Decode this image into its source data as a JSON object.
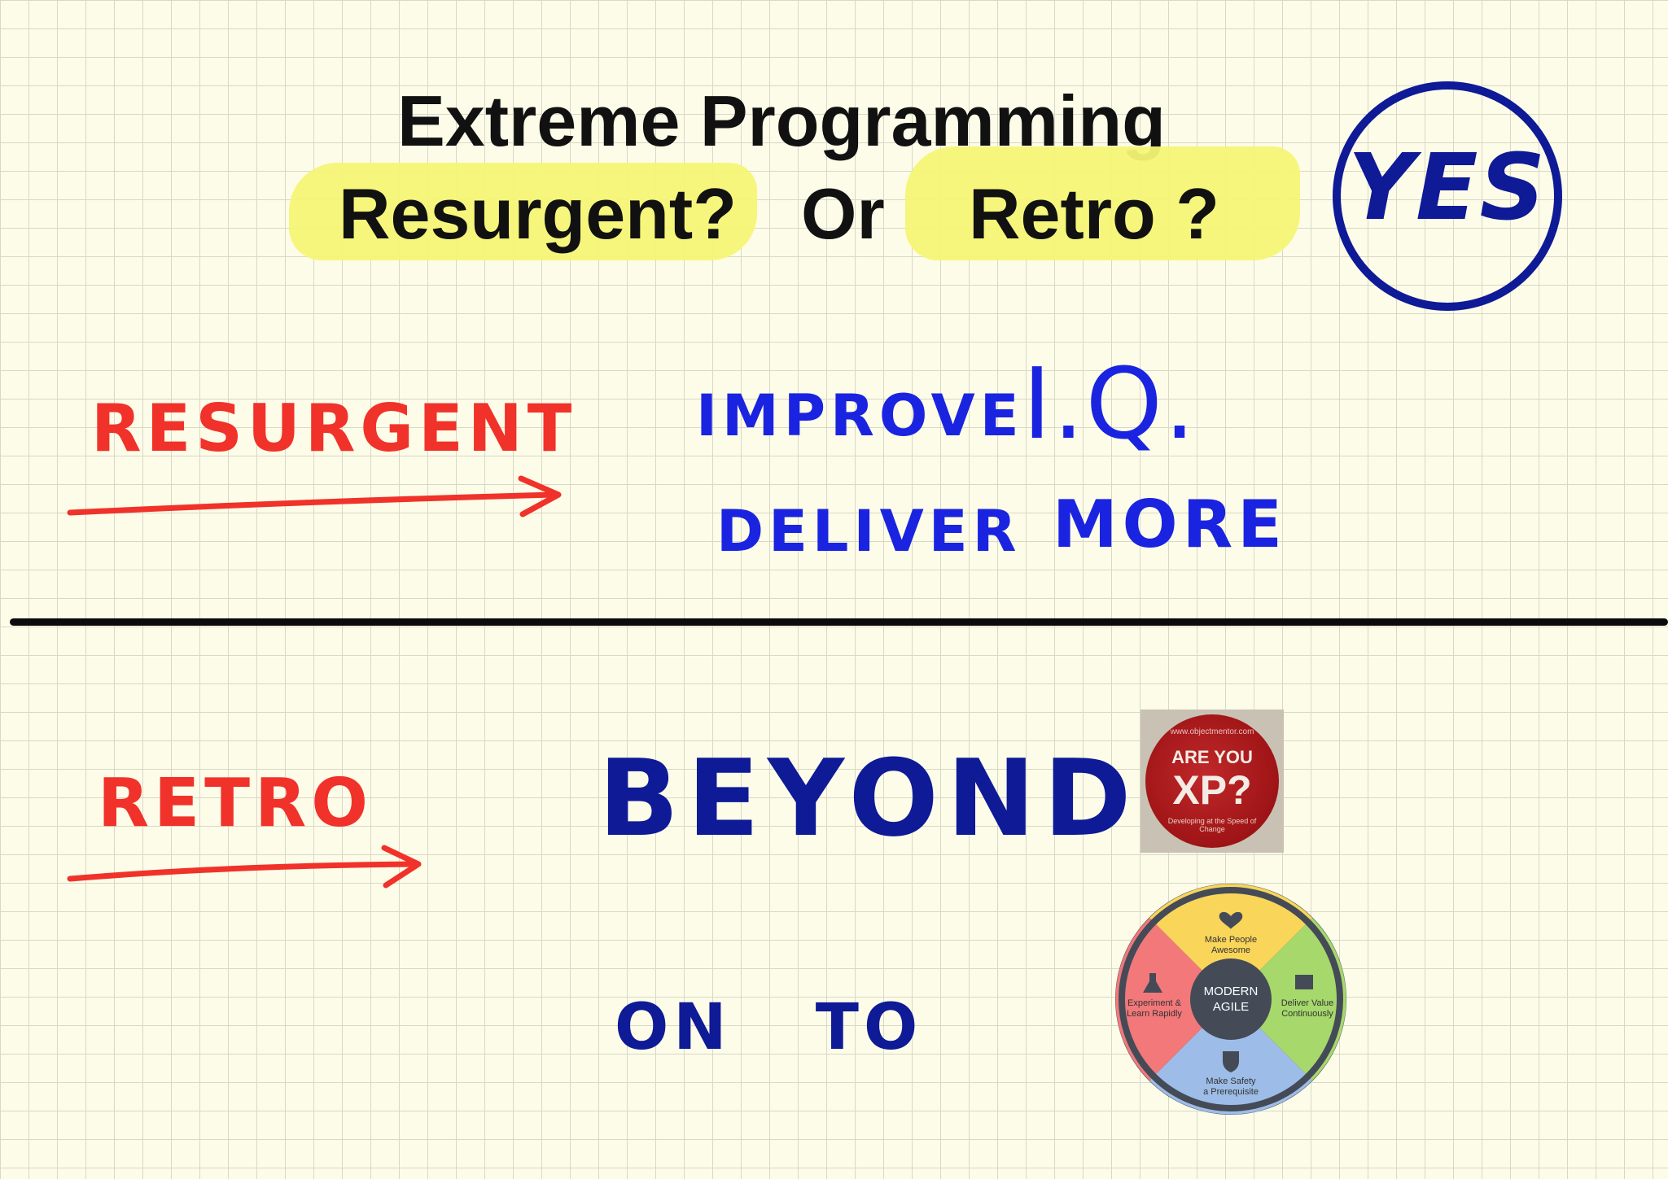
{
  "title": "Extreme Programming",
  "subtitle": {
    "left": "Resurgent?",
    "middle": "Or",
    "right": "Retro ?"
  },
  "answer": "YES",
  "resurgent": {
    "label": "RESURGENT",
    "points": [
      "IMPROVE",
      "I.Q.",
      "DELIVER",
      "MORE"
    ]
  },
  "retro": {
    "label": "RETRO",
    "beyond": "BEYOND",
    "on_to": "ON TO"
  },
  "badge": {
    "url": "www.objectmentor.com",
    "line1": "ARE YOU",
    "line2": "XP?",
    "tagline": "Developing at the Speed of Change"
  },
  "modern_agile": {
    "center_line1": "MODERN",
    "center_line2": "AGILE",
    "top_line1": "Make People",
    "top_line2": "Awesome",
    "right_line1": "Deliver Value",
    "right_line2": "Continuously",
    "bottom_line1": "Make Safety",
    "bottom_line2": "a Prerequisite",
    "left_line1": "Experiment &",
    "left_line2": "Learn Rapidly"
  },
  "colors": {
    "highlight": "#f5f576",
    "red_ink": "#f0322a",
    "blue_ink": "#1a24e0",
    "navy_ink": "#0e1a96",
    "wheel_yellow": "#f9d55a",
    "wheel_green": "#a6d86c",
    "wheel_blue": "#9dbde8",
    "wheel_red": "#f2787a",
    "wheel_center": "#444b57"
  }
}
